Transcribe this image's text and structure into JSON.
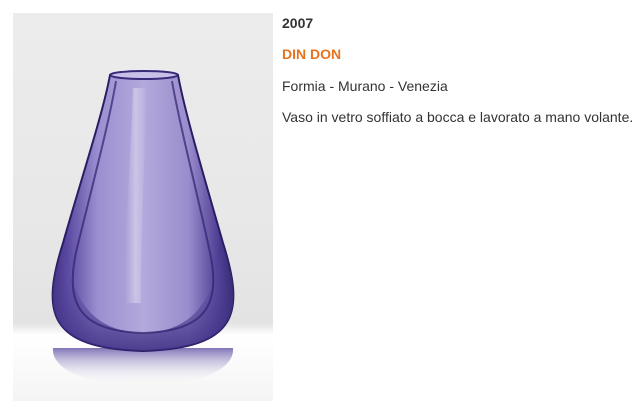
{
  "product": {
    "year": "2007",
    "title": "DIN DON",
    "place": "Formia - Murano - Venezia",
    "description": "Vaso in vetro soffiato a bocca e lavorato a mano volante."
  },
  "colors": {
    "title_accent": "#e8731e",
    "text": "#333333",
    "glass": "#6b5aa8"
  },
  "image": {
    "subject": "purple-glass-vase"
  }
}
